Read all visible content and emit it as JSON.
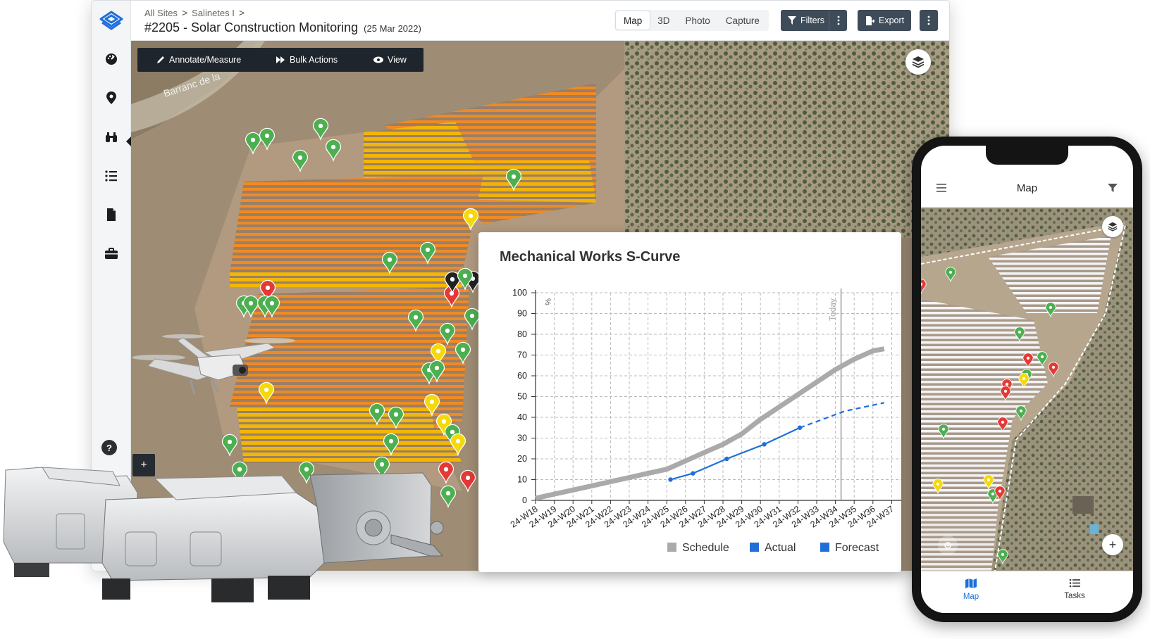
{
  "app": {
    "breadcrumbs": [
      "All Sites",
      "Salinetes I"
    ],
    "breadcrumb_sep": ">",
    "title": "#2205 - Solar Construction Monitoring",
    "date": "(25 Mar 2022)",
    "view_tabs": [
      {
        "label": "Map",
        "active": true
      },
      {
        "label": "3D",
        "active": false
      },
      {
        "label": "Photo",
        "active": false
      },
      {
        "label": "Capture",
        "active": false
      }
    ],
    "filters_label": "Filters",
    "export_label": "Export",
    "sidebar_icons": [
      "dashboard-icon",
      "location-pin-icon",
      "binoculars-icon",
      "list-icon",
      "document-icon",
      "briefcase-icon"
    ],
    "help_label": "?",
    "zoom_in_label": "+"
  },
  "map_toolbar": {
    "annotate": "Annotate/Measure",
    "bulk": "Bulk Actions",
    "view": "View"
  },
  "map_place_label": "Barranc de la",
  "colors": {
    "accent": "#1e6fd9",
    "toolbar_dark": "#3e4b59",
    "marker_green": "#4caf50",
    "marker_yellow": "#f5d90a",
    "marker_red": "#e53935",
    "marker_black": "#222222",
    "panel_orange": "#f08a24",
    "panel_yellow": "#f2b705"
  },
  "chart_data": {
    "type": "line",
    "title": "Mechanical Works S-Curve",
    "ylabel": "%",
    "ylim": [
      0,
      100
    ],
    "yticks": [
      0,
      10,
      20,
      30,
      40,
      50,
      60,
      70,
      80,
      90,
      100
    ],
    "categories": [
      "24-W18",
      "24-W19",
      "24-W20",
      "24-W21",
      "24-W22",
      "24-W23",
      "24-W24",
      "24-W25",
      "24-W26",
      "24-W27",
      "24-W28",
      "24-W29",
      "24-W30",
      "24-W31",
      "24-W32",
      "24-W33",
      "24-W34",
      "24-W35",
      "24-W36",
      "24-W37"
    ],
    "today_label": "Today",
    "today_index": 16.3,
    "grid": true,
    "legend_position": "bottom",
    "series": [
      {
        "name": "Schedule",
        "color": "#aaaaaa",
        "style": "thick",
        "x": [
          0,
          1,
          2,
          3,
          4,
          5,
          6,
          7,
          8,
          9,
          10,
          11,
          12,
          13,
          14,
          15,
          16,
          17,
          18,
          18.6
        ],
        "values": [
          1,
          3,
          5,
          7,
          9,
          11,
          13,
          15,
          19,
          23,
          27,
          32,
          39,
          45,
          51,
          57,
          63,
          68,
          72,
          73
        ]
      },
      {
        "name": "Actual",
        "color": "#1e6fd9",
        "style": "solid",
        "x": [
          7.2,
          8.4,
          10.2,
          12.2,
          14.1
        ],
        "values": [
          10,
          13,
          20,
          27,
          35
        ]
      },
      {
        "name": "Forecast",
        "color": "#1e6fd9",
        "style": "dashed",
        "x": [
          14.1,
          16.5,
          18.6
        ],
        "values": [
          35,
          43,
          47
        ]
      }
    ]
  },
  "phone": {
    "title": "Map",
    "tabs": [
      {
        "label": "Map",
        "active": true
      },
      {
        "label": "Tasks",
        "active": false
      }
    ],
    "zoom_in_label": "+"
  }
}
